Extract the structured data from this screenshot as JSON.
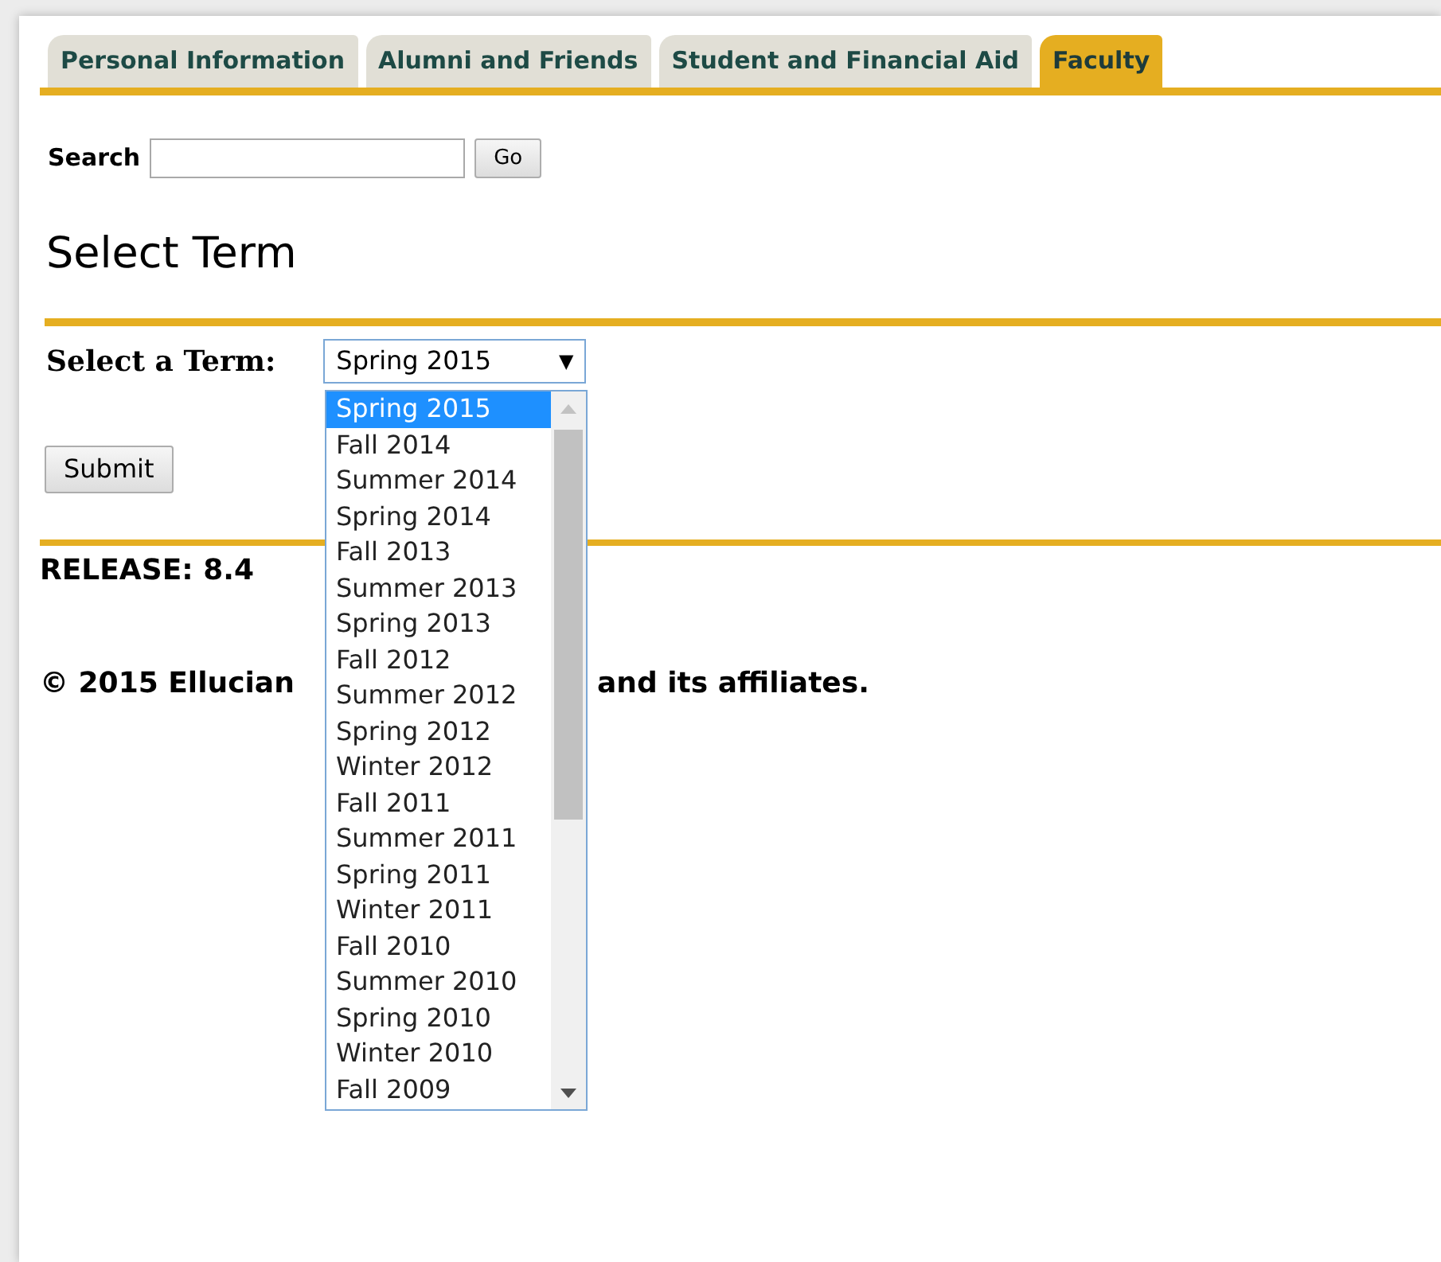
{
  "tabs": [
    {
      "label": "Personal Information",
      "selected": false
    },
    {
      "label": "Alumni and Friends",
      "selected": false
    },
    {
      "label": "Student and Financial Aid",
      "selected": false
    },
    {
      "label": "Faculty",
      "selected": true
    }
  ],
  "search": {
    "label": "Search",
    "button": "Go"
  },
  "heading": "Select Term",
  "term_select": {
    "label": "Select a Term:",
    "value": "Spring 2015",
    "caret": "▼",
    "expanded": true,
    "options": [
      {
        "label": "Spring 2015",
        "selected": true
      },
      {
        "label": "Fall 2014",
        "selected": false
      },
      {
        "label": "Summer 2014",
        "selected": false
      },
      {
        "label": "Spring 2014",
        "selected": false
      },
      {
        "label": "Fall 2013",
        "selected": false
      },
      {
        "label": "Summer 2013",
        "selected": false
      },
      {
        "label": "Spring 2013",
        "selected": false
      },
      {
        "label": "Fall 2012",
        "selected": false
      },
      {
        "label": "Summer 2012",
        "selected": false
      },
      {
        "label": "Spring 2012",
        "selected": false
      },
      {
        "label": "Winter 2012",
        "selected": false
      },
      {
        "label": "Fall 2011",
        "selected": false
      },
      {
        "label": "Summer 2011",
        "selected": false
      },
      {
        "label": "Spring 2011",
        "selected": false
      },
      {
        "label": "Winter 2011",
        "selected": false
      },
      {
        "label": "Fall 2010",
        "selected": false
      },
      {
        "label": "Summer 2010",
        "selected": false
      },
      {
        "label": "Spring 2010",
        "selected": false
      },
      {
        "label": "Winter 2010",
        "selected": false
      },
      {
        "label": "Fall 2009",
        "selected": false
      }
    ]
  },
  "submit": "Submit",
  "release": "RELEASE: 8.4",
  "copyright": [
    "© 2015 Ellucian",
    "and its affiliates."
  ]
}
